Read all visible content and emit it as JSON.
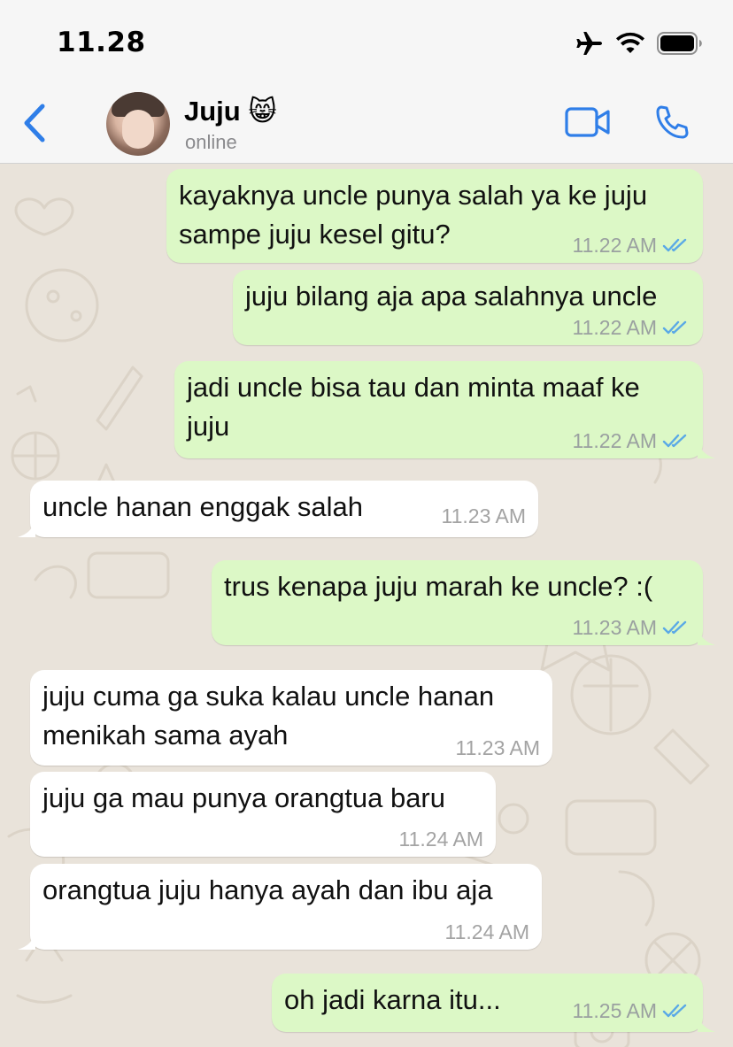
{
  "status_bar": {
    "time": "11.28",
    "icons": [
      "airplane-icon",
      "wifi-icon",
      "battery-icon"
    ]
  },
  "header": {
    "contact_name": "Juju 😸",
    "contact_status": "online",
    "icons": [
      "back-chevron-icon",
      "video-call-icon",
      "phone-icon"
    ]
  },
  "colors": {
    "accent": "#2f7ee8",
    "outgoing_bubble": "#dcf8c6",
    "incoming_bubble": "#ffffff",
    "read_ticks": "#5aa9e6",
    "wallpaper": "#e9e3da"
  },
  "messages": [
    {
      "direction": "out",
      "lines": [
        "kayaknya uncle punya salah ya ke juju",
        "sampe juju kesel gitu?"
      ],
      "time": "11.22 AM",
      "read": true
    },
    {
      "direction": "out",
      "lines": [
        "juju bilang aja apa salahnya uncle"
      ],
      "time": "11.22 AM",
      "read": true
    },
    {
      "direction": "out",
      "lines": [
        "jadi uncle bisa tau dan minta maaf ke",
        "juju"
      ],
      "time": "11.22 AM",
      "read": true
    },
    {
      "direction": "in",
      "lines": [
        "uncle hanan enggak salah"
      ],
      "time": "11.23 AM"
    },
    {
      "direction": "out",
      "lines": [
        "trus kenapa juju marah ke uncle? :("
      ],
      "time": "11.23 AM",
      "read": true
    },
    {
      "direction": "in",
      "lines": [
        "juju cuma ga suka kalau uncle hanan",
        "menikah sama ayah"
      ],
      "time": "11.23 AM"
    },
    {
      "direction": "in",
      "lines": [
        "juju ga mau punya orangtua baru"
      ],
      "time": "11.24 AM"
    },
    {
      "direction": "in",
      "lines": [
        "orangtua juju hanya ayah dan ibu aja"
      ],
      "time": "11.24 AM"
    },
    {
      "direction": "out",
      "lines": [
        "oh jadi karna itu..."
      ],
      "time": "11.25 AM",
      "read": true
    }
  ]
}
